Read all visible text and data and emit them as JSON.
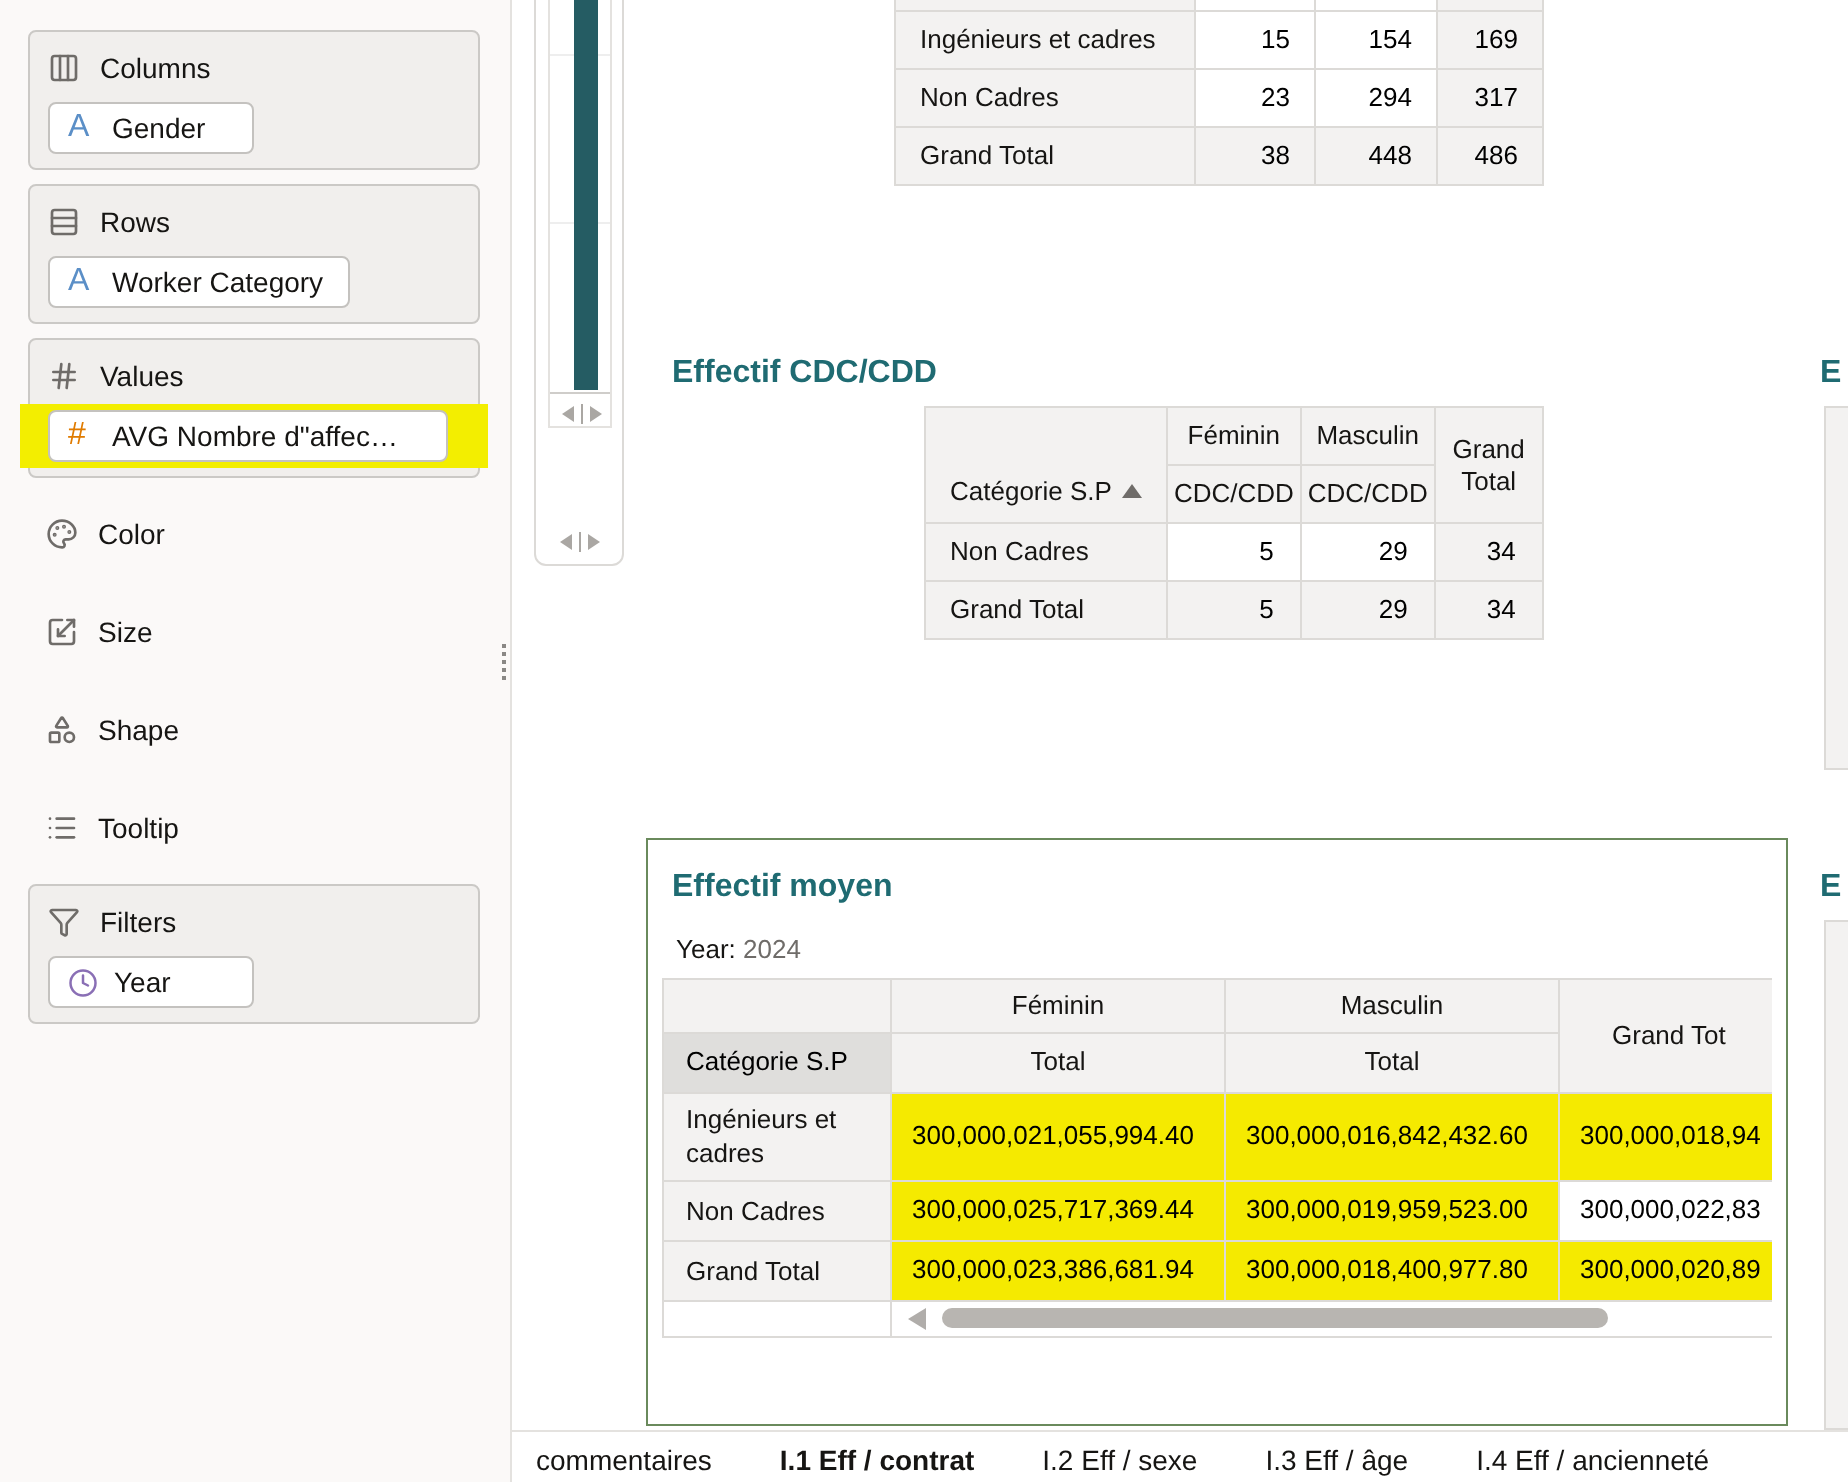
{
  "sidebar": {
    "sections": [
      {
        "kind": "columns",
        "label": "Columns",
        "pills": [
          {
            "kind": "attribute",
            "glyph": "A",
            "label": "Gender",
            "highlighted": false
          }
        ]
      },
      {
        "kind": "rows",
        "label": "Rows",
        "pills": [
          {
            "kind": "attribute",
            "glyph": "A",
            "label": "Worker Category",
            "highlighted": false
          }
        ]
      },
      {
        "kind": "values",
        "label": "Values",
        "pills": [
          {
            "kind": "measure",
            "glyph": "#",
            "label": "AVG Nombre d\"affec…",
            "highlighted": true
          }
        ]
      },
      {
        "kind": "color",
        "label": "Color"
      },
      {
        "kind": "size",
        "label": "Size"
      },
      {
        "kind": "shape",
        "label": "Shape"
      },
      {
        "kind": "tooltip",
        "label": "Tooltip"
      },
      {
        "kind": "filters",
        "label": "Filters",
        "pills": [
          {
            "kind": "date",
            "label": "Year",
            "highlighted": false
          }
        ]
      }
    ]
  },
  "top_table": {
    "rows": [
      {
        "label": "Ingénieurs et cadres",
        "cells": [
          "15",
          "154",
          "169"
        ]
      },
      {
        "label": "Non Cadres",
        "cells": [
          "23",
          "294",
          "317"
        ]
      },
      {
        "label": "Grand Total",
        "cells": [
          "38",
          "448",
          "486"
        ]
      }
    ]
  },
  "cdc_table": {
    "title": "Effectif CDC/CDD",
    "row_header": "Catégorie S.P",
    "groups": [
      "Féminin",
      "Masculin"
    ],
    "sub_headers": [
      "CDC/CDD",
      "CDC/CDD"
    ],
    "total_header": "Grand Total",
    "rows": [
      {
        "label": "Non Cadres",
        "cells": [
          "5",
          "29",
          "34"
        ]
      },
      {
        "label": "Grand Total",
        "cells": [
          "5",
          "29",
          "34"
        ]
      }
    ]
  },
  "moyen_table": {
    "title": "Effectif moyen",
    "filter_label": "Year:",
    "filter_value": "2024",
    "row_header": "Catégorie S.P",
    "groups": [
      "Féminin",
      "Masculin"
    ],
    "sub_headers": [
      "Total",
      "Total"
    ],
    "total_header": "Grand Tot",
    "rows": [
      {
        "label": "Ingénieurs et cadres",
        "cells": [
          {
            "text": "300,000,021,055,994.40",
            "highlighted": true
          },
          {
            "text": "300,000,016,842,432.60",
            "highlighted": true
          },
          {
            "text": "300,000,018,94",
            "highlighted": true
          }
        ]
      },
      {
        "label": "Non Cadres",
        "cells": [
          {
            "text": "300,000,025,717,369.44",
            "highlighted": true
          },
          {
            "text": "300,000,019,959,523.00",
            "highlighted": true
          },
          {
            "text": "300,000,022,83",
            "highlighted": false
          }
        ]
      },
      {
        "label": "Grand Total",
        "cells": [
          {
            "text": "300,000,023,386,681.94",
            "highlighted": true
          },
          {
            "text": "300,000,018,400,977.80",
            "highlighted": true
          },
          {
            "text": "300,000,020,89",
            "highlighted": true
          }
        ]
      }
    ]
  },
  "right_titles": [
    "E",
    "E"
  ],
  "tabs": [
    {
      "label": "commentaires",
      "selected": false
    },
    {
      "label": "I.1 Eff / contrat",
      "selected": true
    },
    {
      "label": "I.2 Eff / sexe",
      "selected": false
    },
    {
      "label": "I.3 Eff / âge",
      "selected": false
    },
    {
      "label": "I.4 Eff / ancienneté",
      "selected": false
    }
  ]
}
